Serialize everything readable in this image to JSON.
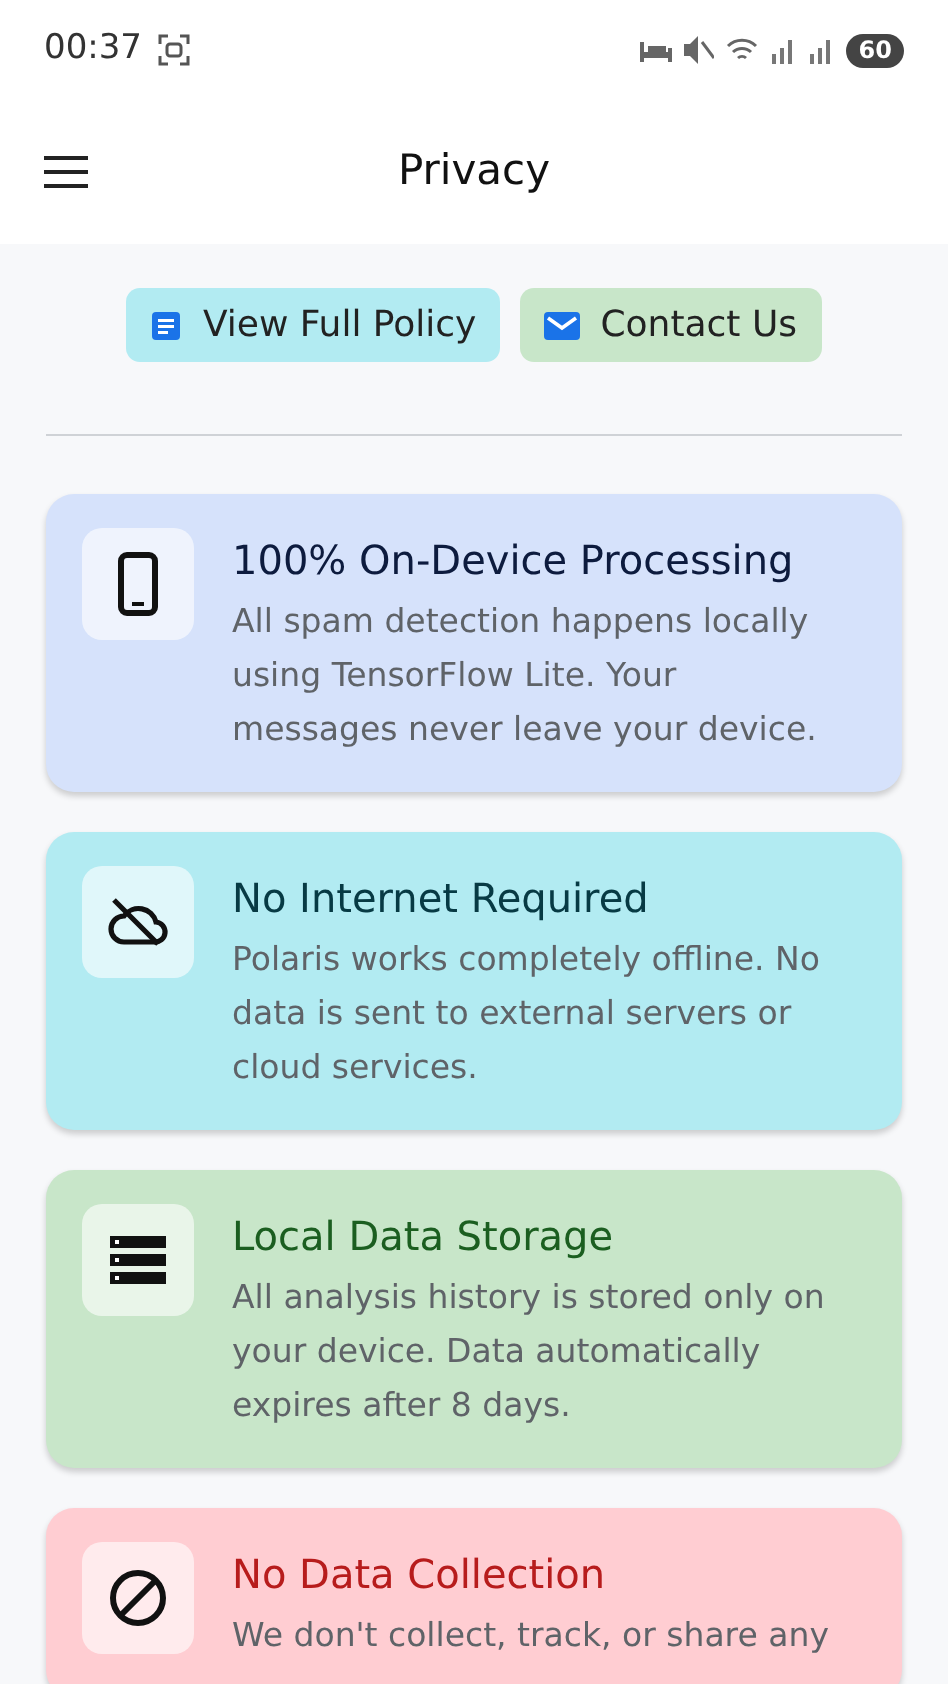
{
  "status_bar": {
    "time": "00:37",
    "battery": "60"
  },
  "app_bar": {
    "title": "Privacy"
  },
  "actions": [
    {
      "kind": "document",
      "label": "View Full Policy",
      "color": "#b2ebf2"
    },
    {
      "kind": "mail",
      "label": "Contact Us",
      "color": "#c8e6c9"
    }
  ],
  "cards": [
    {
      "kind": "phone",
      "color": "#d6e2fb",
      "title": "100% On-Device Processing",
      "description": "All spam detection happens locally using TensorFlow Lite. Your messages never leave your device."
    },
    {
      "kind": "cloud-off",
      "color": "#b2ebf2",
      "title": "No Internet Required",
      "description": "Polaris works completely offline. No data is sent to external servers or cloud services."
    },
    {
      "kind": "storage",
      "color": "#c8e6c9",
      "title": "Local Data Storage",
      "description": "All analysis history is stored only on your device. Data automatically expires after 8 days."
    },
    {
      "kind": "block",
      "color": "#ffcdd2",
      "title": "No Data Collection",
      "description": "We don't collect, track, or share any"
    }
  ]
}
